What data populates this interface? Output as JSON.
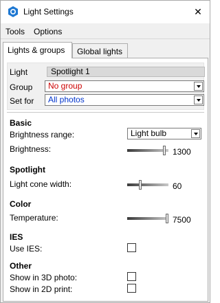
{
  "window": {
    "title": "Light Settings",
    "close_glyph": "✕"
  },
  "menu": {
    "items": [
      "Tools",
      "Options"
    ]
  },
  "tabs": [
    "Lights & groups",
    "Global lights"
  ],
  "selection": {
    "light_label": "Light",
    "light_value": "Spotlight 1",
    "group_label": "Group",
    "group_value": "No group",
    "setfor_label": "Set for",
    "setfor_value": "All photos"
  },
  "basic": {
    "heading": "Basic",
    "brightness_range_label": "Brightness range:",
    "brightness_range_value": "Light bulb",
    "brightness_label": "Brightness:",
    "brightness_value": "1300",
    "brightness_level": 0.92
  },
  "spotlight": {
    "heading": "Spotlight",
    "cone_label": "Light cone width:",
    "cone_value": "60",
    "cone_level": 0.3
  },
  "color": {
    "heading": "Color",
    "temperature_label": "Temperature:",
    "temperature_value": "7500",
    "temperature_level": 1.0
  },
  "ies": {
    "heading": "IES",
    "use_label": "Use IES:",
    "use_checked": false
  },
  "other": {
    "heading": "Other",
    "show3d_label": "Show in 3D photo:",
    "show3d_checked": false,
    "show2d_label": "Show in 2D print:",
    "show2d_checked": false
  },
  "colors": {
    "accent": "#1e78d2",
    "link_value": "#0033cc",
    "warning_value": "#cc0000"
  }
}
